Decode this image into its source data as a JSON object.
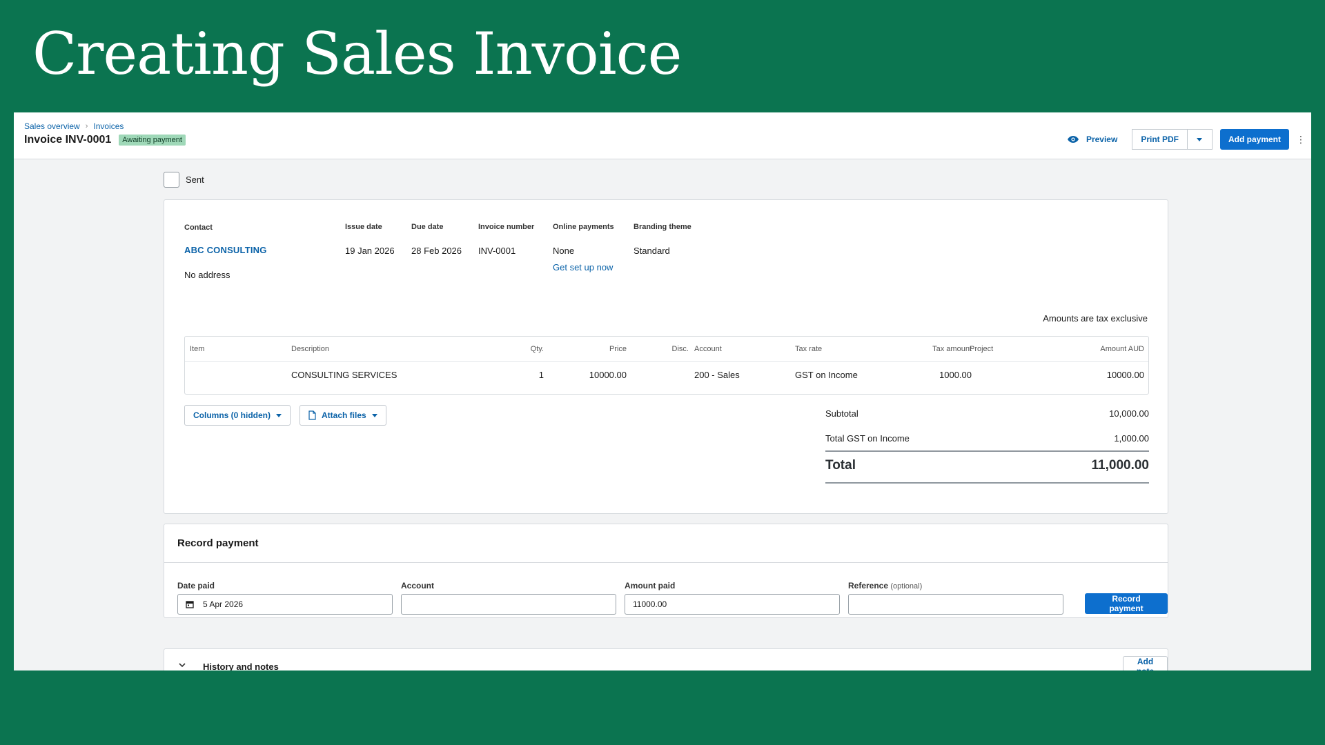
{
  "slide": {
    "title": "Creating Sales Invoice"
  },
  "header": {
    "breadcrumb": [
      "Sales overview",
      "Invoices"
    ],
    "breadcrumb_separator": "›",
    "title": "Invoice INV-0001",
    "status_badge": "Awaiting payment",
    "preview_label": "Preview",
    "print_pdf_label": "Print PDF",
    "add_payment_label": "Add payment",
    "more_icon": "⋮"
  },
  "sent": {
    "label": "Sent",
    "checked": false
  },
  "invoice": {
    "contact_label": "Contact",
    "contact_name": "ABC CONSULTING",
    "address": "No address",
    "issue_date_label": "Issue date",
    "issue_date": "19 Jan 2026",
    "due_date_label": "Due date",
    "due_date": "28 Feb 2026",
    "invoice_number_label": "Invoice number",
    "invoice_number": "INV-0001",
    "online_payments_label": "Online payments",
    "online_payments": "None",
    "setup_link": "Get set up now",
    "branding_label": "Branding theme",
    "branding": "Standard",
    "tax_note": "Amounts are tax exclusive",
    "columns": {
      "item": "Item",
      "description": "Description",
      "qty": "Qty.",
      "price": "Price",
      "disc": "Disc.",
      "account": "Account",
      "tax_rate": "Tax rate",
      "tax_amount": "Tax amount",
      "project": "Project",
      "amount": "Amount AUD"
    },
    "line": {
      "item": "",
      "description": "CONSULTING SERVICES",
      "qty": "1",
      "price": "10000.00",
      "disc": "",
      "account": "200 - Sales",
      "tax_rate": "GST on Income",
      "tax_amount": "1000.00",
      "project": "",
      "amount": "10000.00"
    },
    "columns_button": "Columns (0 hidden)",
    "attach_button": "Attach files",
    "subtotal_label": "Subtotal",
    "subtotal": "10,000.00",
    "gst_label": "Total GST on Income",
    "gst": "1,000.00",
    "total_label": "Total",
    "total": "11,000.00"
  },
  "payment": {
    "heading": "Record payment",
    "date_label": "Date paid",
    "date_value": "5 Apr 2026",
    "account_label": "Account",
    "account_value": "",
    "amount_label": "Amount paid",
    "amount_value": "11000.00",
    "reference_label": "Reference",
    "reference_optional": "(optional)",
    "reference_value": "",
    "button": "Record payment"
  },
  "history": {
    "heading": "History and notes",
    "add_note": "Add note"
  },
  "colors": {
    "slide_bg": "#0b7450",
    "primary_blue": "#0d6fce",
    "link_blue": "#0a62a8",
    "badge_bg": "#9fd8b8"
  }
}
